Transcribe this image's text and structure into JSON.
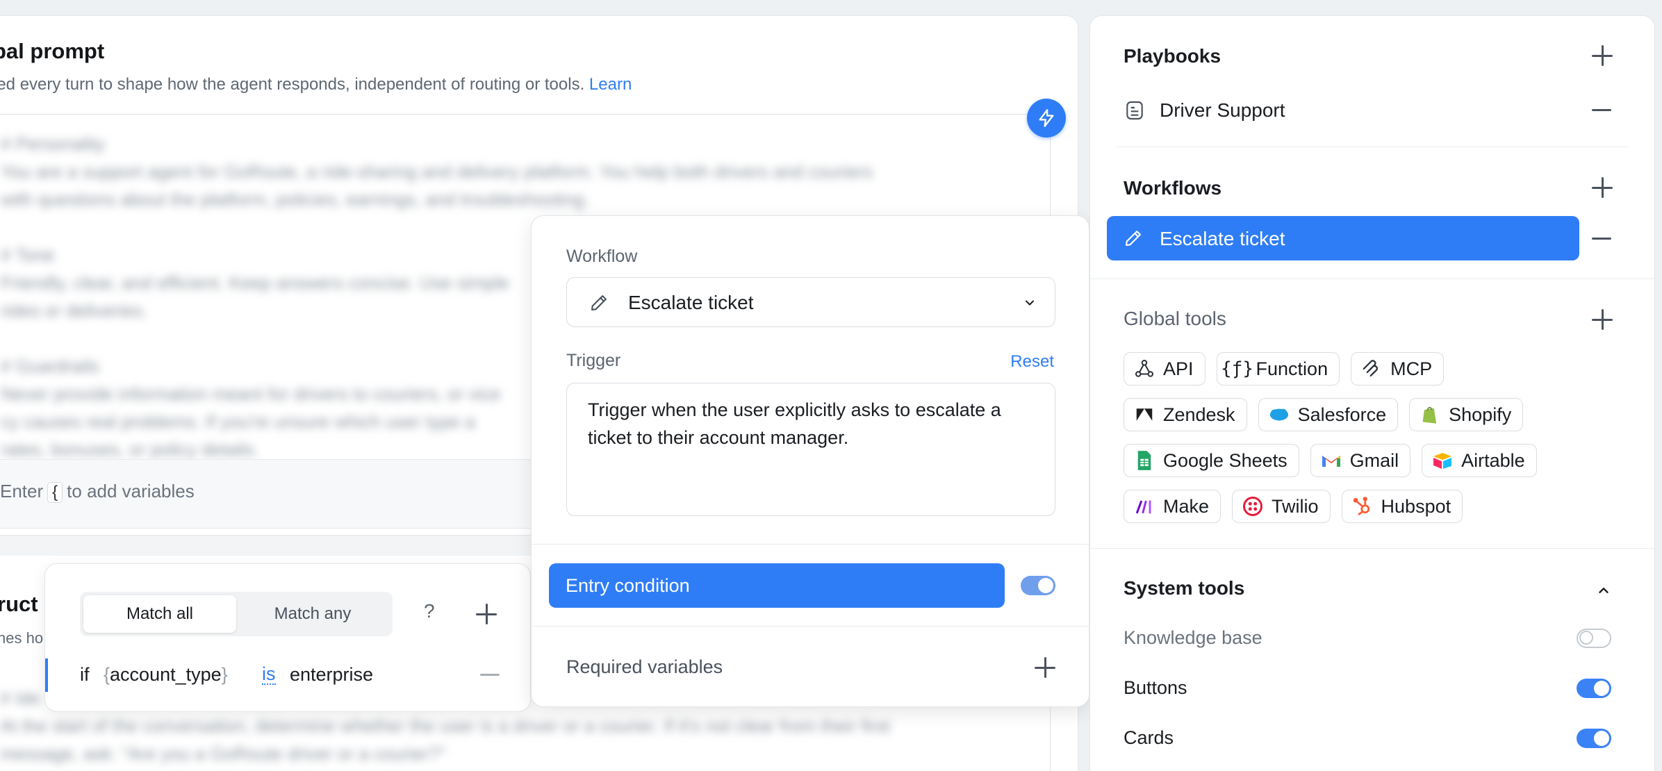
{
  "global_prompt": {
    "title": "bal prompt",
    "description": "ied every turn to shape how the agent responds, independent of routing or tools.",
    "learn_link": "Learn",
    "blurred_lines": [
      "# Personality",
      "You are a support agent for GoRoute, a ride-sharing and delivery platform. You help both drivers and couriers",
      "with questions about the platform, policies, earnings, and troubleshooting.",
      "# Tone",
      "Friendly, clear, and efficient. Keep answers concise. Use simple",
      "rides or deliveries.",
      "# Guardrails",
      "Never provide information meant for drivers to couriers, or vice",
      "cy causes real problems. If you're unsure which user type a",
      "rates, bonuses, or policy details."
    ],
    "variables_hint_prefix": "Enter",
    "variables_hint_brace": "{",
    "variables_hint_suffix": "to add variables"
  },
  "instructions": {
    "title": "ruct",
    "description": "nes ho",
    "blurred_lines": [
      "# Ide",
      "At the start of the conversation, determine whether the user is a driver or a courier. If it's not clear from their first",
      "message, ask: \"Are you a GoRoute driver or a courier?\""
    ]
  },
  "condition_popover": {
    "match_all": "Match all",
    "match_any": "Match any",
    "help": "?",
    "row": {
      "keyword": "if",
      "brace_open": "{",
      "variable": "account_type",
      "brace_close": "}",
      "operator": "is",
      "value": "enterprise"
    }
  },
  "workflow_popover": {
    "workflow_label": "Workflow",
    "workflow_value": "Escalate ticket",
    "trigger_label": "Trigger",
    "reset": "Reset",
    "trigger_text": "Trigger when the user explicitly asks to escalate a ticket to their account manager.",
    "entry_condition": "Entry condition",
    "entry_enabled": true,
    "required_variables": "Required variables"
  },
  "sidebar": {
    "playbooks_title": "Playbooks",
    "playbooks": [
      {
        "label": "Driver Support"
      }
    ],
    "workflows_title": "Workflows",
    "workflows": [
      {
        "label": "Escalate ticket",
        "selected": true
      }
    ],
    "global_tools_title": "Global tools",
    "tools": [
      [
        {
          "label": "API",
          "icon": "api-icon"
        },
        {
          "label": "Function",
          "icon": "function-icon"
        },
        {
          "label": "MCP",
          "icon": "mcp-icon"
        }
      ],
      [
        {
          "label": "Zendesk",
          "icon": "zendesk-icon"
        },
        {
          "label": "Salesforce",
          "icon": "salesforce-icon"
        },
        {
          "label": "Shopify",
          "icon": "shopify-icon"
        }
      ],
      [
        {
          "label": "Google Sheets",
          "icon": "google-sheets-icon"
        },
        {
          "label": "Gmail",
          "icon": "gmail-icon"
        },
        {
          "label": "Airtable",
          "icon": "airtable-icon"
        }
      ],
      [
        {
          "label": "Make",
          "icon": "make-icon"
        },
        {
          "label": "Twilio",
          "icon": "twilio-icon"
        },
        {
          "label": "Hubspot",
          "icon": "hubspot-icon"
        }
      ]
    ],
    "system_tools_title": "System tools",
    "system_tools": [
      {
        "label": "Knowledge base",
        "enabled": false
      },
      {
        "label": "Buttons",
        "enabled": true
      },
      {
        "label": "Cards",
        "enabled": true
      }
    ]
  },
  "colors": {
    "accent": "#2f7df6",
    "background": "#eef1f3"
  }
}
